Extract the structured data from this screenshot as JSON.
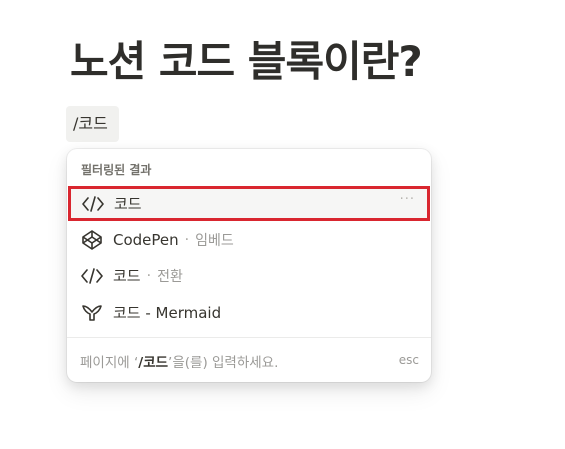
{
  "page": {
    "title": "노션 코드 블록이란?"
  },
  "editor": {
    "slash_input": "/코드"
  },
  "menu": {
    "header": "필터링된 결과",
    "items": [
      {
        "label": "코드",
        "sub": "",
        "icon": "code-brackets-icon",
        "selected": true,
        "more": "···"
      },
      {
        "label": "CodePen",
        "sub": "임베드",
        "icon": "codepen-icon",
        "selected": false
      },
      {
        "label": "코드",
        "sub": "전환",
        "icon": "code-brackets-icon",
        "selected": false
      },
      {
        "label": "코드 - Mermaid",
        "sub": "",
        "icon": "mermaid-icon",
        "selected": false
      }
    ],
    "separator": "·",
    "footer": {
      "prefix": "페이지에 ‘",
      "command": "/코드",
      "suffix": "’을(를) 입력하세요.",
      "esc": "esc"
    }
  },
  "colors": {
    "highlight_border": "#d9262f",
    "chip_bg": "#f1f1ef",
    "text": "#37352f",
    "muted": "#9b9a97"
  }
}
